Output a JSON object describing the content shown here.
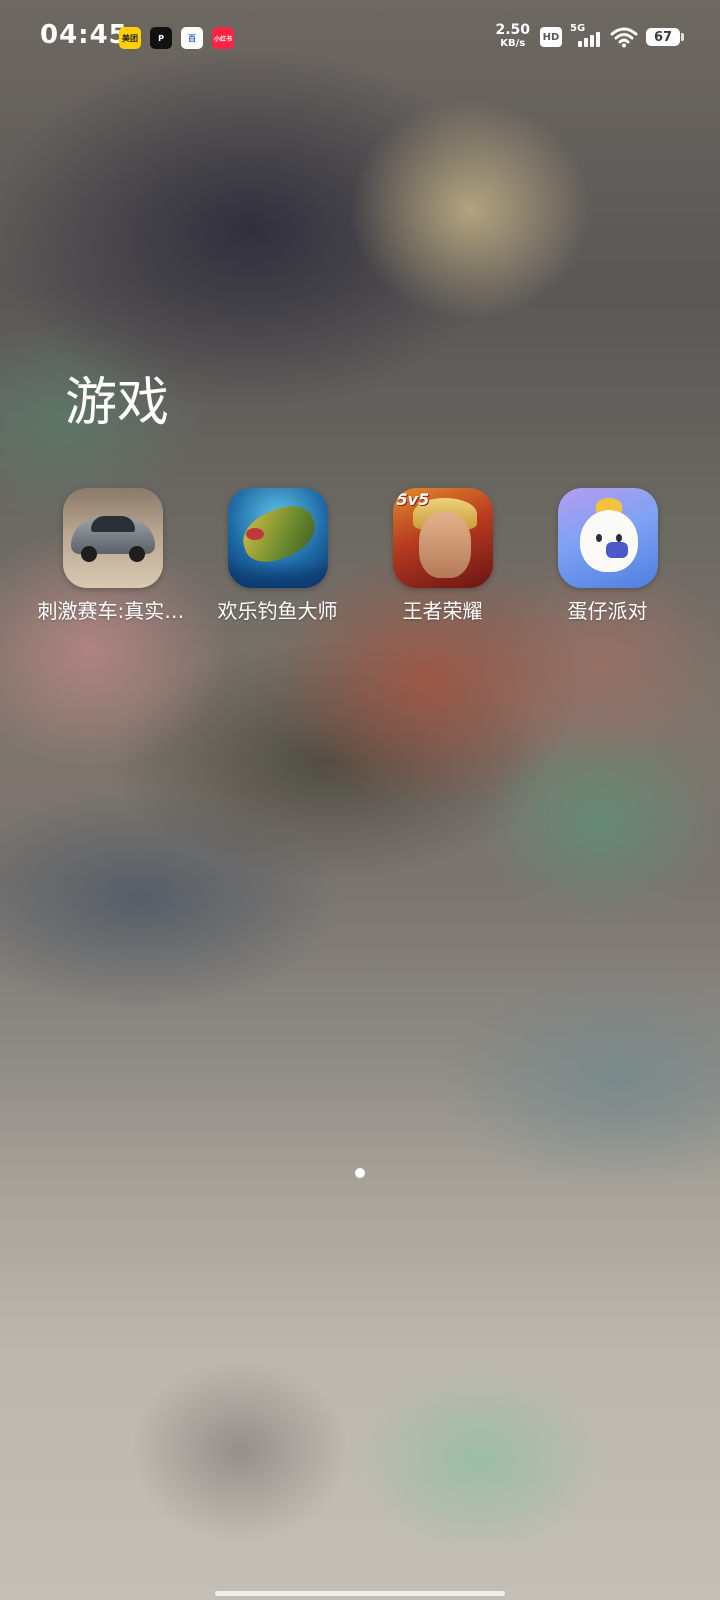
{
  "status_bar": {
    "time": "04:45",
    "notification_icons": [
      {
        "name": "meituan-icon",
        "text": "美团"
      },
      {
        "name": "pinduoduo-icon",
        "text": "P"
      },
      {
        "name": "baidu-icon",
        "text": "百"
      },
      {
        "name": "xiaohongshu-icon",
        "text": "小红书"
      }
    ],
    "network_speed_value": "2.50",
    "network_speed_unit": "KB/s",
    "hd_label": "HD",
    "network_type": "5G",
    "battery_level": "67"
  },
  "folder": {
    "title": "游戏",
    "apps": [
      {
        "label": "刺激赛车:真实驾驶",
        "icon": "race-car-app-icon"
      },
      {
        "label": "欢乐钓鱼大师",
        "icon": "fishing-app-icon"
      },
      {
        "label": "王者荣耀",
        "icon": "honor-of-kings-app-icon"
      },
      {
        "label": "蛋仔派对",
        "icon": "eggy-party-app-icon"
      }
    ]
  },
  "page_indicator": {
    "pages": 1,
    "current": 1
  },
  "colors": {
    "text": "#ffffff"
  }
}
